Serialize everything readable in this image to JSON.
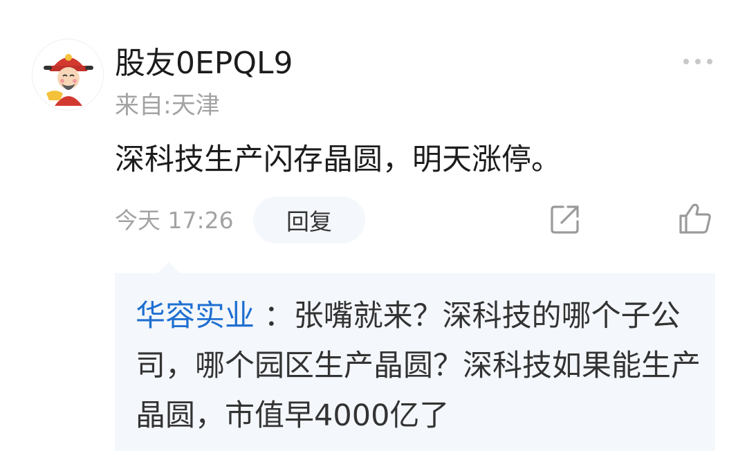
{
  "comment": {
    "username": "股友0EPQL9",
    "location": "来自:天津",
    "content": "深科技生产闪存晶圆，明天涨停。",
    "time": "今天 17:26",
    "reply_label": "回复"
  },
  "quoted_reply": {
    "author": "华容实业",
    "separator": " ：",
    "text": "张嘴就来？深科技的哪个子公司，哪个园区生产晶圆？深科技如果能生产晶圆，市值早4000亿了"
  },
  "icons": {
    "avatar": "cartoon-fortune-god-avatar",
    "more": "more-dots-icon",
    "share": "share-icon",
    "like": "thumbs-up-icon"
  },
  "colors": {
    "author_link": "#1f6fd1",
    "muted_text": "#a3a3a3",
    "quote_background": "#f4f7fb"
  }
}
